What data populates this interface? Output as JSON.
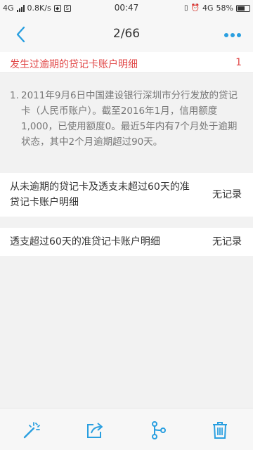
{
  "status_bar": {
    "network_left": "4G",
    "speed": "0.8K/s",
    "time": "00:47",
    "network_right": "4G",
    "battery": "58%"
  },
  "nav": {
    "title": "2/66",
    "accent_color": "#2a9fe0"
  },
  "section": {
    "title": "发生过逾期的贷记卡账户明细",
    "count": "1",
    "color": "#e14848"
  },
  "details": [
    {
      "index": "1.",
      "text": "2011年9月6日中国建设银行深圳市分行发放的贷记卡（人民币账户）。截至2016年1月，信用额度1,000，已使用额度0。最近5年内有7个月处于逾期状态，其中2个月逾期超过90天。"
    }
  ],
  "rows": [
    {
      "label": "从未逾期的贷记卡及透支未超过60天的准贷记卡账户明细",
      "value": "无记录"
    },
    {
      "label": "透支超过60天的准贷记卡账户明细",
      "value": "无记录"
    }
  ],
  "toolbar": {
    "icons": [
      "magic-wand-icon",
      "share-icon",
      "branch-icon",
      "trash-icon"
    ]
  }
}
